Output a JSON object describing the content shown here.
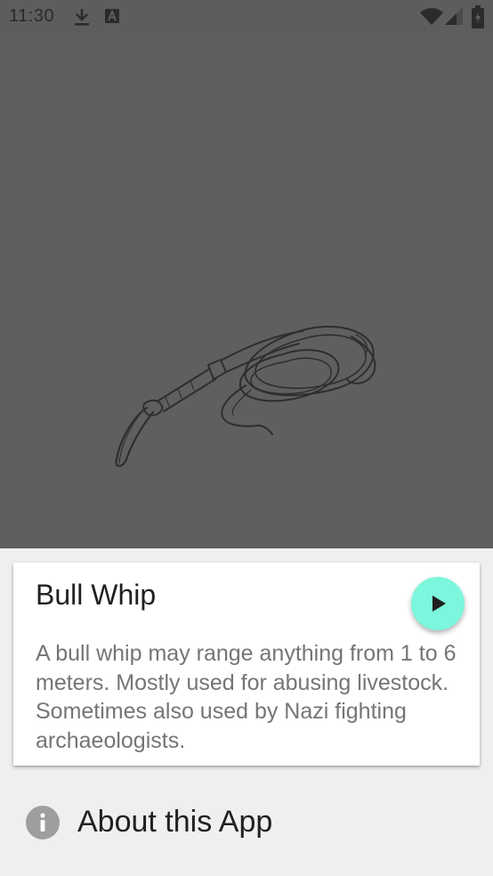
{
  "status_bar": {
    "time": "11:30",
    "icons": [
      "download-icon",
      "a-notification-icon",
      "wifi-icon",
      "signal-icon",
      "battery-icon"
    ]
  },
  "image": {
    "subject": "bull-whip-sketch",
    "background_color": "#5f5f5f"
  },
  "card": {
    "title": "Bull Whip",
    "description": "A bull whip may range anything from 1 to 6 meters.  Mostly used for abusing livestock.  Sometimes also used by Nazi fighting archaeologists.",
    "play_icon": "play-icon",
    "play_button_color": "#7cf6dc"
  },
  "about": {
    "label": "About this App",
    "icon": "info-icon"
  },
  "colors": {
    "screen_background": "#efefef",
    "status_bar": "#5d5d5d"
  }
}
